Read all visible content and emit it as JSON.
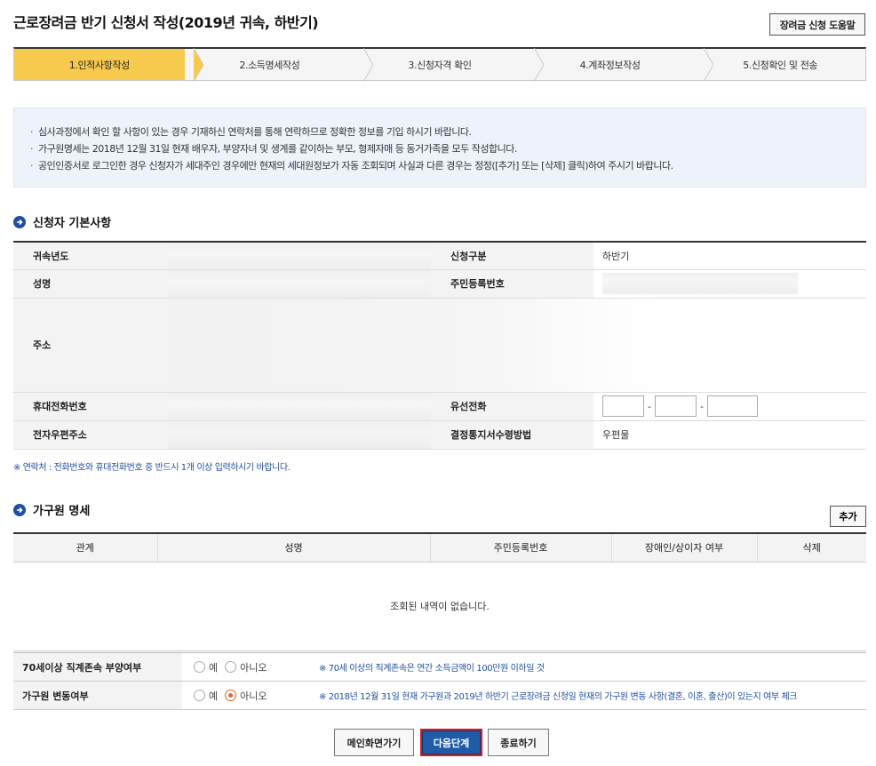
{
  "page": {
    "title": "근로장려금 반기 신청서 작성(2019년 귀속, 하반기)",
    "help_button": "장려금 신청 도움말"
  },
  "steps": [
    {
      "label": "1.인적사항작성",
      "active": true
    },
    {
      "label": "2.소득명세작성",
      "active": false
    },
    {
      "label": "3.신청자격 확인",
      "active": false
    },
    {
      "label": "4.계좌정보작성",
      "active": false
    },
    {
      "label": "5.신청확인 및 전송",
      "active": false
    }
  ],
  "notice": [
    "심사과정에서 확인 할 사항이 있는 경우 기재하신 연락처를 통해 연락하므로 정확한 정보를 기입 하시기 바랍니다.",
    "가구원명세는 2018년 12월 31일 현재 배우자, 부양자녀 및 생계를 같이하는 부모, 형제자매 등 동거가족을 모두 작성합니다.",
    "공인인증서로 로그인한 경우 신청자가 세대주인 경우에만 현재의 세대원정보가 자동 조회되며 사실과 다른 경우는 정정([추가] 또는 [삭제] 클릭)하여 주시기 바랍니다."
  ],
  "applicant": {
    "section_title": "신청자 기본사항",
    "labels": {
      "year": "귀속년도",
      "apply_type": "신청구분",
      "name": "성명",
      "rrn": "주민등록번호",
      "address": "주소",
      "mobile": "휴대전화번호",
      "landline": "유선전화",
      "email": "전자우편주소",
      "notice_method": "결정통지서수령방법"
    },
    "values": {
      "apply_type": "하반기",
      "notice_method": "우편물"
    },
    "phone_separator": "-",
    "contact_note": "※ 연락처 : 전화번호와 휴대전화번호 중 반드시 1개 이상 입력하시기 바랍니다."
  },
  "family": {
    "section_title": "가구원 명세",
    "add_button": "추가",
    "columns": [
      "관계",
      "성명",
      "주민등록번호",
      "장애인/상이자 여부",
      "삭제"
    ],
    "empty_message": "조회된 내역이 없습니다."
  },
  "options": [
    {
      "label": "70세이상 직계존속 부양여부",
      "yes": "예",
      "no": "아니오",
      "selected": "none",
      "note": "※ 70세 이상의 직계존속은 연간 소득금액이 100만원 이하일 것"
    },
    {
      "label": "가구원 변동여부",
      "yes": "예",
      "no": "아니오",
      "selected": "no",
      "note": "※ 2018년 12월 31일 현재 가구원과 2019년 하반기 근로장려금 신청일 현재의 가구원 변동 사항(결혼, 이혼, 출산)이 있는지 여부 체크"
    }
  ],
  "buttons": {
    "main": "메인화면가기",
    "next": "다음단계",
    "close": "종료하기"
  },
  "colors": {
    "active_step": "#f7ca4e",
    "accent_blue": "#1f4f9f",
    "primary_button": "#1f5ca8",
    "highlight_border": "#e0161a",
    "radio_checked": "#e0682a"
  }
}
